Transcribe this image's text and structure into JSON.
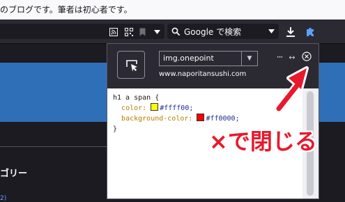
{
  "page_header_text": "のブログです。筆者は初心者です。",
  "search": {
    "placeholder": "Google で検索"
  },
  "popup": {
    "format_value": "img.onepoint",
    "site_url": "www.naporitansushi.com",
    "code": {
      "selector": "h1 a span {",
      "line1_prop": "color:",
      "line1_val": "#ffff00;",
      "line2_prop": "background-color:",
      "line2_val": "#ff0000;",
      "close": "}"
    },
    "swatch_colors": {
      "color": "#ffff00",
      "background": "#ff0000"
    },
    "more_label": "···",
    "resize_label": "↔"
  },
  "page": {
    "category_heading": "ゴリー",
    "link_fragment": "2)"
  },
  "annotation": {
    "text": "×で閉じる",
    "color": "#e8192c"
  },
  "icons": [
    "rss-icon",
    "qr-code-icon",
    "bookmark-icon",
    "chevron-down-icon",
    "search-icon",
    "download-icon",
    "extension-icon",
    "picker-icon",
    "close-icon"
  ]
}
